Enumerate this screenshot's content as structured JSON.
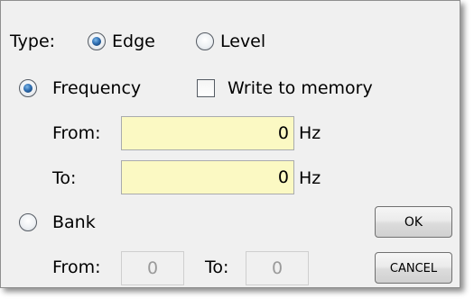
{
  "type_row": {
    "label": "Type:",
    "options": [
      {
        "label": "Edge",
        "selected": true
      },
      {
        "label": "Level",
        "selected": false
      }
    ]
  },
  "frequency": {
    "label": "Frequency",
    "selected": true,
    "write_to_memory": {
      "label": "Write to memory",
      "checked": false
    },
    "from": {
      "label": "From:",
      "value": "0",
      "unit": "Hz"
    },
    "to": {
      "label": "To:",
      "value": "0",
      "unit": "Hz"
    }
  },
  "bank": {
    "label": "Bank",
    "selected": false,
    "from": {
      "label": "From:",
      "value": "0"
    },
    "to": {
      "label": "To:",
      "value": "0"
    }
  },
  "buttons": {
    "ok": "OK",
    "cancel": "CANCEL"
  },
  "colors": {
    "input_background": "#fbf9c3",
    "dialog_background": "#f0f0f0",
    "radio_selected": "#2f6fb3"
  }
}
